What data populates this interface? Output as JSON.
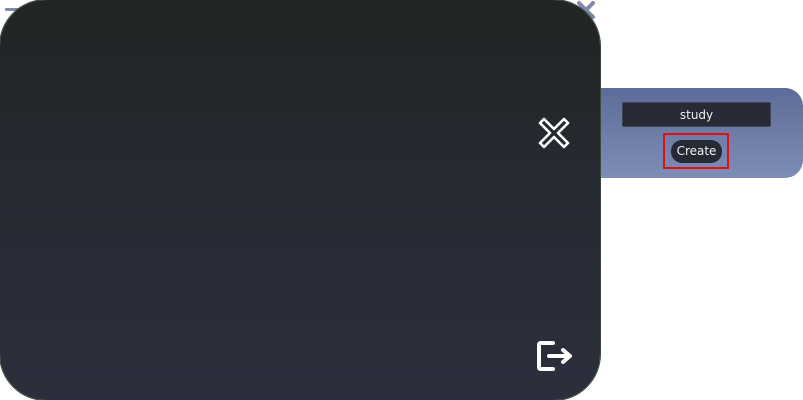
{
  "window": {
    "minimize_icon": "minus-icon",
    "close_icon": "close-icon"
  },
  "side_panel": {
    "name_value": "study",
    "create_label": "Create",
    "highlight_color": "#e01010",
    "gradient_top": "#5d6c98",
    "gradient_bottom": "#7e8db6"
  },
  "main_panel": {
    "close_icon": "close-x-icon",
    "exit_icon": "sign-out-icon",
    "background_top": "#222524",
    "background_bottom": "#2c2e3d"
  }
}
